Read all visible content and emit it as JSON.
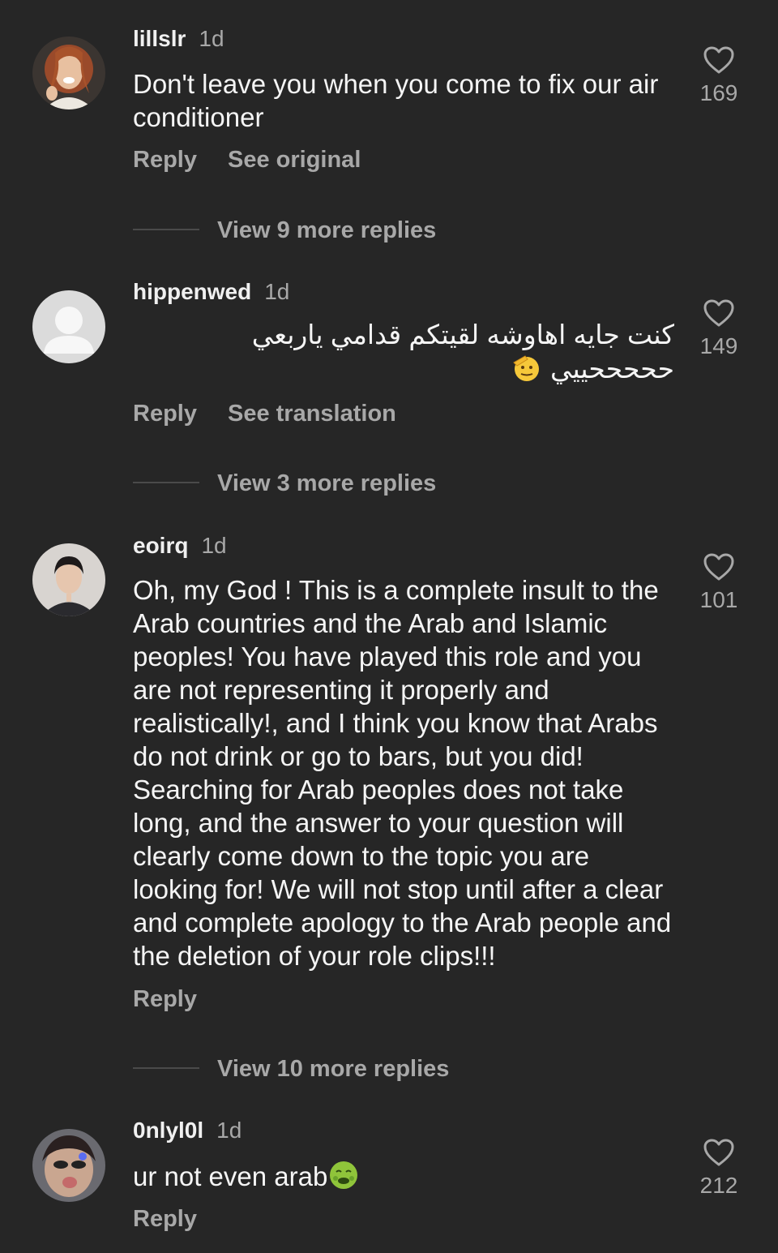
{
  "comments": [
    {
      "username": "lillslr",
      "time": "1d",
      "text": "Don't leave you when you come to fix our air conditioner",
      "reply_label": "Reply",
      "secondary_label": "See original",
      "likes": "169",
      "view_more": "View 9 more replies"
    },
    {
      "username": "hippenwed",
      "time": "1d",
      "text": "كنت جايه اهاوشه لقيتكم قدامي ياربعي حححححييي",
      "emoji": "saluting-face-emoji",
      "reply_label": "Reply",
      "secondary_label": "See translation",
      "likes": "149",
      "view_more": "View 3 more replies"
    },
    {
      "username": "eoirq",
      "time": "1d",
      "text": "Oh, my God ! This is a complete insult to the Arab countries and the Arab and Islamic peoples! You have played this role and you are not representing it properly and realistically!, and I think you know that Arabs do not drink or go to bars, but you did! Searching for Arab peoples does not take long, and the answer to your question will clearly come down to the topic you are looking for! We will not stop until after a clear and complete apology to the Arab people and the deletion of your role clips!!!",
      "reply_label": "Reply",
      "likes": "101",
      "view_more": "View 10 more replies"
    },
    {
      "username": "0nlyl0l",
      "time": "1d",
      "text": "ur not even arab",
      "emoji": "nauseated-face-emoji",
      "reply_label": "Reply",
      "likes": "212"
    }
  ],
  "icons": {
    "like": "heart-outline-icon",
    "default_avatar": "default-avatar-icon"
  },
  "colors": {
    "background": "#262626",
    "primary_text": "#f5f5f5",
    "secondary_text": "#a8a8a8"
  }
}
